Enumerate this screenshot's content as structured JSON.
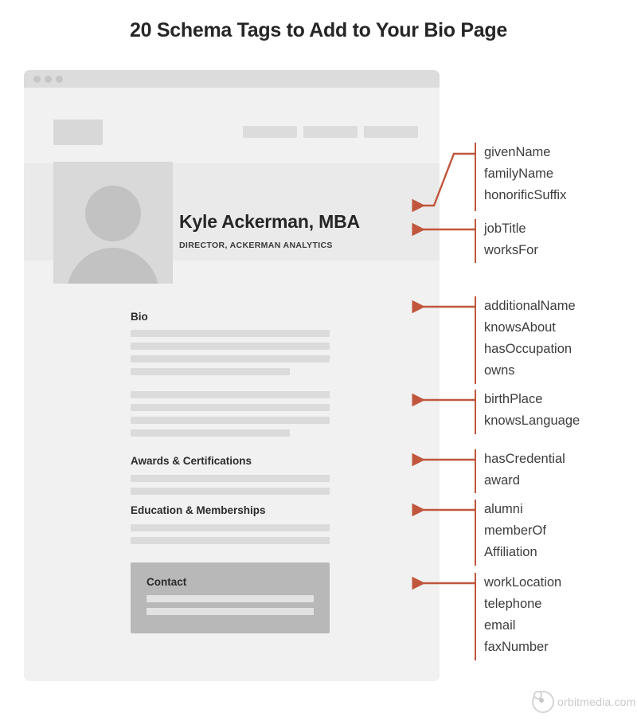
{
  "title": "20 Schema Tags to Add to Your Bio Page",
  "browser": {
    "window_dots": [
      "dot-1",
      "dot-2",
      "dot-3"
    ],
    "nav_placeholders": [
      "nav-item-1",
      "nav-item-2",
      "nav-item-3"
    ],
    "logo_placeholder": "site-logo",
    "profile": {
      "name": "Kyle Ackerman, MBA",
      "role": "DIRECTOR, ACKERMAN ANALYTICS",
      "avatar_alt": "person-avatar-placeholder"
    },
    "sections": [
      {
        "heading": "Bio"
      },
      {
        "heading": "Awards & Certifications"
      },
      {
        "heading": "Education & Memberships"
      }
    ],
    "contact": {
      "heading": "Contact"
    }
  },
  "annotations": [
    {
      "id": "name-tags",
      "tags": [
        "givenName",
        "familyName",
        "honorificSuffix"
      ]
    },
    {
      "id": "job-tags",
      "tags": [
        "jobTitle",
        "worksFor"
      ]
    },
    {
      "id": "bio-tags",
      "tags": [
        "additionalName",
        "knowsAbout",
        "hasOccupation",
        "owns"
      ]
    },
    {
      "id": "origin-tags",
      "tags": [
        "birthPlace",
        "knowsLanguage"
      ]
    },
    {
      "id": "award-tags",
      "tags": [
        "hasCredential",
        "award"
      ]
    },
    {
      "id": "membership-tags",
      "tags": [
        "alumni",
        "memberOf",
        "Affiliation"
      ]
    },
    {
      "id": "contact-tags",
      "tags": [
        "workLocation",
        "telephone",
        "email",
        "faxNumber"
      ]
    }
  ],
  "footer": {
    "brand": "orbitmedia.com"
  },
  "colors": {
    "accent": "#c0563c",
    "text": "#3d3d3d",
    "heading": "#262626",
    "window_bg": "#f1f1f1",
    "placeholder": "#dbdbdb"
  }
}
